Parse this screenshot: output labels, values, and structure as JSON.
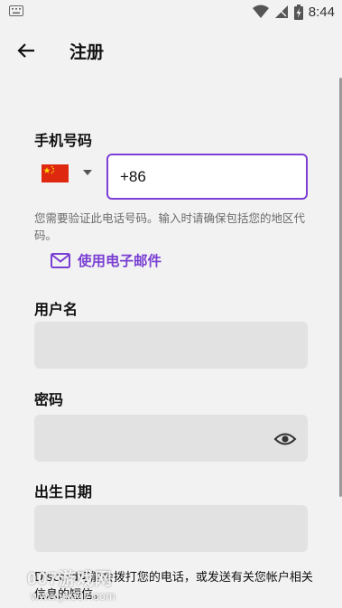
{
  "status_bar": {
    "time": "8:44"
  },
  "app_bar": {
    "title": "注册"
  },
  "phone": {
    "label": "手机号码",
    "country_flag": "china-flag-icon",
    "value": "+86",
    "hint": "您需要验证此电话号码。输入时请确保包括您的地区代码。"
  },
  "email_link": {
    "label": "使用电子邮件"
  },
  "username": {
    "label": "用户名",
    "value": ""
  },
  "password": {
    "label": "密码",
    "value": ""
  },
  "birthdate": {
    "label": "出生日期",
    "value": ""
  },
  "bottom_text": "Discord可能会拨打您的电话，或发送有关您帐户相关信息的短信。",
  "watermark": {
    "brand": "007游戏网",
    "url": "www.yx007.com"
  },
  "colors": {
    "accent": "#7d3fd6",
    "field_bg": "#e2e2e2",
    "page_bg": "#f2f2f2"
  }
}
